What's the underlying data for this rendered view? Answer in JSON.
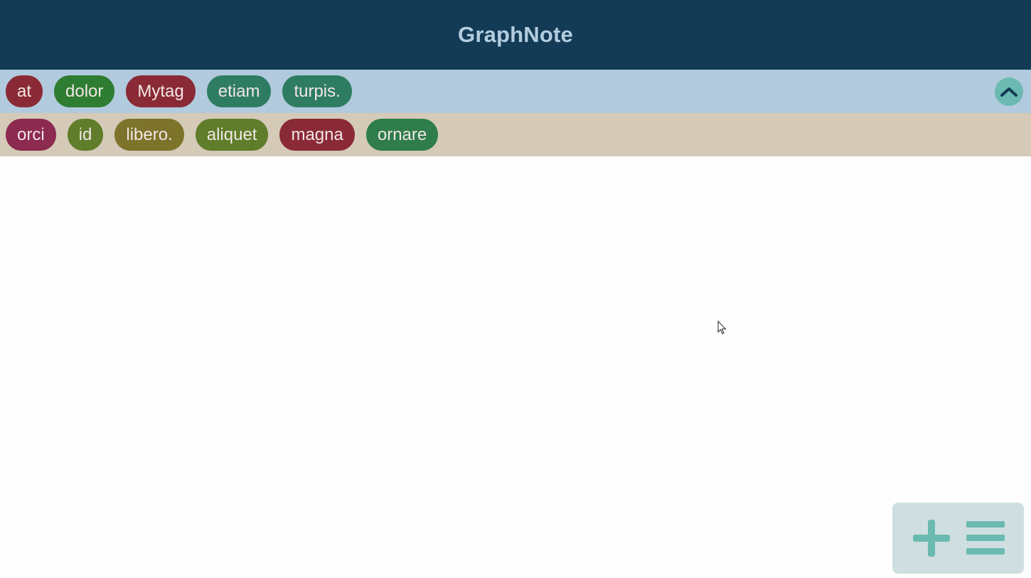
{
  "app": {
    "title": "GraphNote"
  },
  "selected_tags": {
    "items": [
      {
        "label": "at",
        "color": "#8a2a36"
      },
      {
        "label": "dolor",
        "color": "#2e7d32"
      },
      {
        "label": "Mytag",
        "color": "#8a2a36"
      },
      {
        "label": "etiam",
        "color": "#2e7d63"
      },
      {
        "label": "turpis.",
        "color": "#2e7d63"
      }
    ],
    "collapse_icon": "chevron-up-icon"
  },
  "available_tags": {
    "items": [
      {
        "label": "orci",
        "color": "#8c2a4f"
      },
      {
        "label": "id",
        "color": "#5f7d2a"
      },
      {
        "label": "libero.",
        "color": "#7d732a"
      },
      {
        "label": "aliquet",
        "color": "#5f7d2a"
      },
      {
        "label": "magna",
        "color": "#8a2a36"
      },
      {
        "label": "ornare",
        "color": "#2e7d4a"
      }
    ]
  },
  "actions": {
    "add_icon": "plus-icon",
    "menu_icon": "menu-icon",
    "accent_color": "#6bbab1"
  },
  "colors": {
    "header_bg": "#143b55",
    "header_text": "#b3cde0",
    "selected_bar_bg": "#b2cadd",
    "available_bar_bg": "#d4cab7",
    "panel_bg": "#cfdfe1"
  }
}
